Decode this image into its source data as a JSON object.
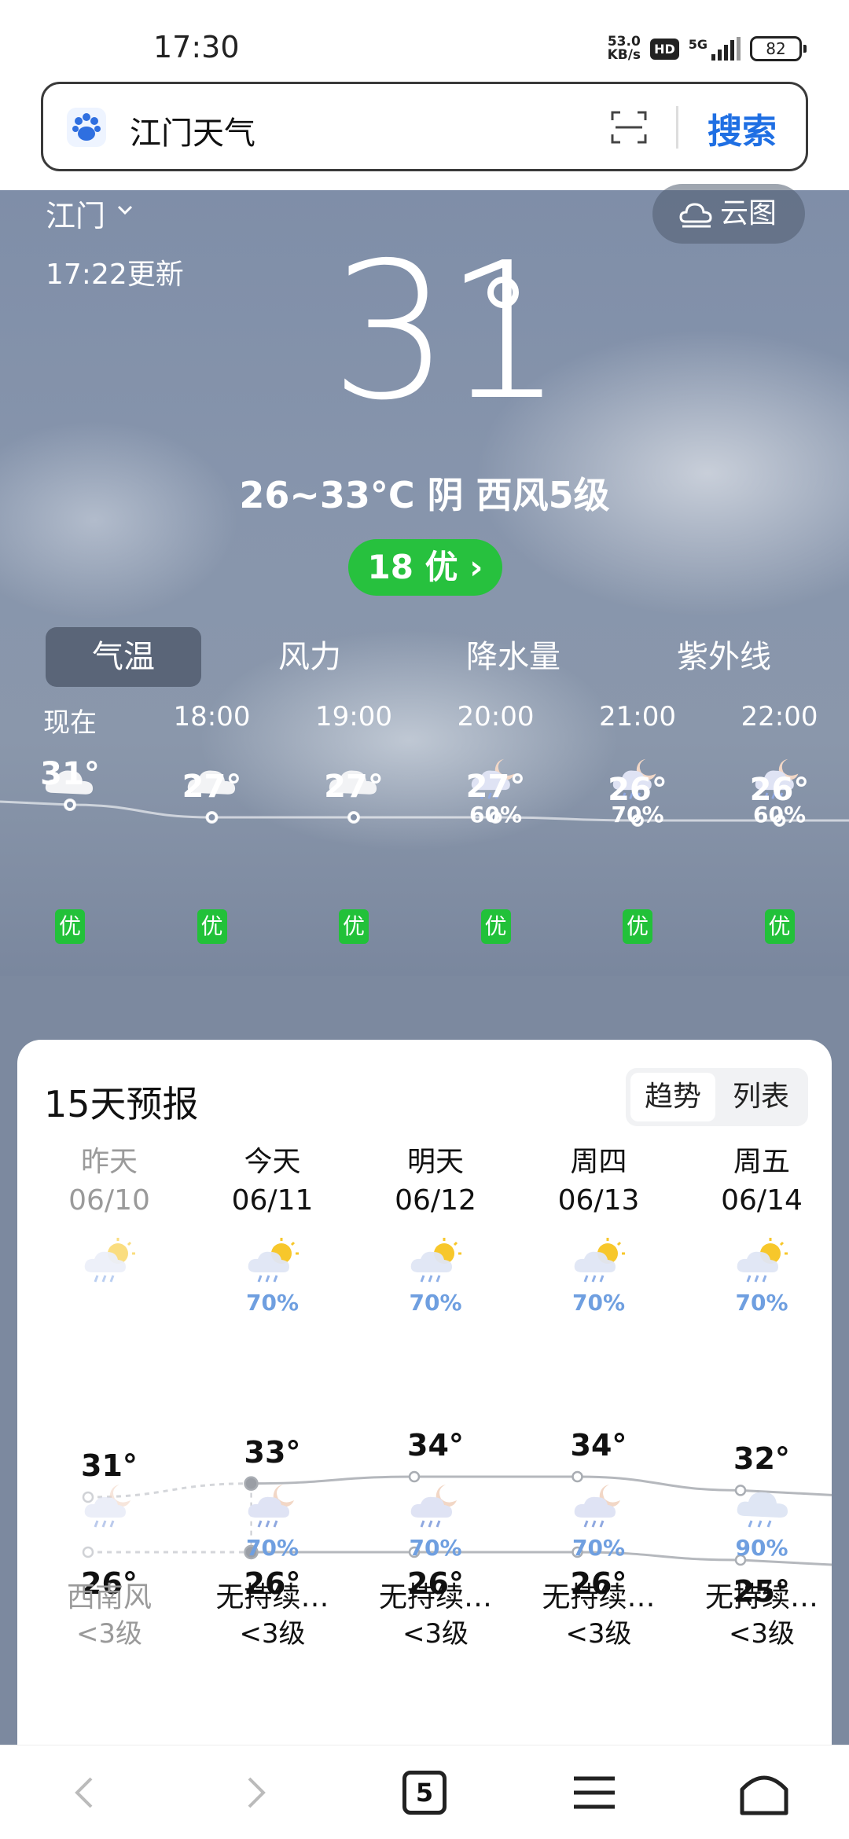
{
  "status": {
    "time": "17:30",
    "net_speed_value": "53.0",
    "net_speed_unit": "KB/s",
    "hd": "HD",
    "network": "5G",
    "battery": "82"
  },
  "search": {
    "query": "江门天气",
    "button": "搜索"
  },
  "weather": {
    "city": "江门",
    "updated": "17:22更新",
    "cloud_map": "云图",
    "current_temp": "31",
    "summary": "26~33°C 阴 西风5级",
    "aqi": "18 优",
    "tabs": [
      "气温",
      "风力",
      "降水量",
      "紫外线"
    ],
    "hourly": [
      {
        "time": "现在",
        "icon": "cloudy-icon",
        "pop": "",
        "temp": "31°",
        "aqi": "优",
        "value": 31
      },
      {
        "time": "18:00",
        "icon": "cloudy-icon",
        "pop": "",
        "temp": "27°",
        "aqi": "优",
        "value": 27
      },
      {
        "time": "19:00",
        "icon": "cloudy-icon",
        "pop": "",
        "temp": "27°",
        "aqi": "优",
        "value": 27
      },
      {
        "time": "20:00",
        "icon": "night-rain-icon",
        "pop": "60%",
        "temp": "27°",
        "aqi": "优",
        "value": 27
      },
      {
        "time": "21:00",
        "icon": "night-rain-icon",
        "pop": "70%",
        "temp": "26°",
        "aqi": "优",
        "value": 26
      },
      {
        "time": "22:00",
        "icon": "night-rain-icon",
        "pop": "60%",
        "temp": "26°",
        "aqi": "优",
        "value": 26
      }
    ]
  },
  "forecast": {
    "title": "15天预报",
    "toggle": [
      "趋势",
      "列表"
    ],
    "days": [
      {
        "name": "昨天",
        "date": "06/10",
        "day_icon": "sun-rain-icon",
        "day_pop": "",
        "high": "31°",
        "low": "26°",
        "night_icon": "night-rain-icon",
        "night_pop": "",
        "wind": "西南风",
        "level": "<3级",
        "high_v": 31,
        "low_v": 26
      },
      {
        "name": "今天",
        "date": "06/11",
        "day_icon": "sun-rain-icon",
        "day_pop": "70%",
        "high": "33°",
        "low": "26°",
        "night_icon": "night-rain-icon",
        "night_pop": "70%",
        "wind": "无持续…",
        "level": "<3级",
        "high_v": 33,
        "low_v": 26
      },
      {
        "name": "明天",
        "date": "06/12",
        "day_icon": "sun-rain-icon",
        "day_pop": "70%",
        "high": "34°",
        "low": "26°",
        "night_icon": "night-rain-icon",
        "night_pop": "70%",
        "wind": "无持续…",
        "level": "<3级",
        "high_v": 34,
        "low_v": 26
      },
      {
        "name": "周四",
        "date": "06/13",
        "day_icon": "sun-rain-icon",
        "day_pop": "70%",
        "high": "34°",
        "low": "26°",
        "night_icon": "night-rain-icon",
        "night_pop": "70%",
        "wind": "无持续…",
        "level": "<3级",
        "high_v": 34,
        "low_v": 26
      },
      {
        "name": "周五",
        "date": "06/14",
        "day_icon": "sun-rain-icon",
        "day_pop": "70%",
        "high": "32°",
        "low": "25°",
        "night_icon": "rain-icon",
        "night_pop": "90%",
        "wind": "无持续…",
        "level": "<3级",
        "high_v": 32,
        "low_v": 25
      }
    ]
  },
  "nav": {
    "tab_count": "5"
  },
  "colors": {
    "accent": "#1f6fe3",
    "aqi_green": "#27c13e",
    "pop_blue": "#6f9fe0"
  }
}
